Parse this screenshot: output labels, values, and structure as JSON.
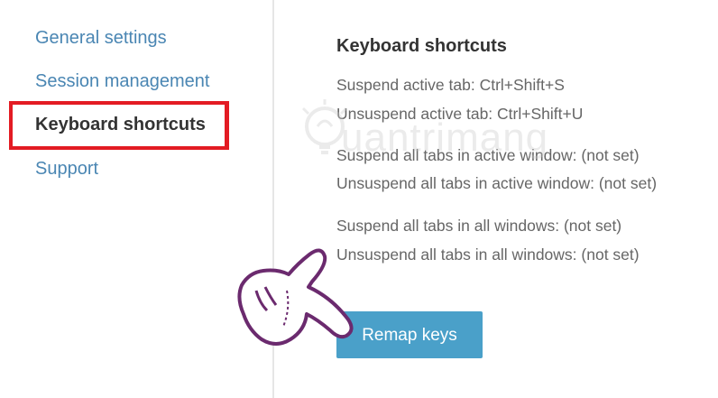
{
  "sidebar": {
    "items": [
      {
        "label": "General settings"
      },
      {
        "label": "Session management"
      },
      {
        "label": "Keyboard shortcuts"
      },
      {
        "label": "Support"
      }
    ]
  },
  "main": {
    "title": "Keyboard shortcuts",
    "shortcuts": [
      "Suspend active tab: Ctrl+Shift+S",
      "Unsuspend active tab: Ctrl+Shift+U",
      "Suspend all tabs in active window: (not set)",
      "Unsuspend all tabs in active window: (not set)",
      "Suspend all tabs in all windows: (not set)",
      "Unsuspend all tabs in all windows: (not set)"
    ],
    "remap_label": "Remap keys"
  },
  "watermark": {
    "text": "uantrimang"
  },
  "colors": {
    "link": "#4a86b3",
    "active": "#333333",
    "highlight": "#e31b23",
    "button": "#4aa0c9",
    "hand_outline": "#6b2a6e"
  }
}
